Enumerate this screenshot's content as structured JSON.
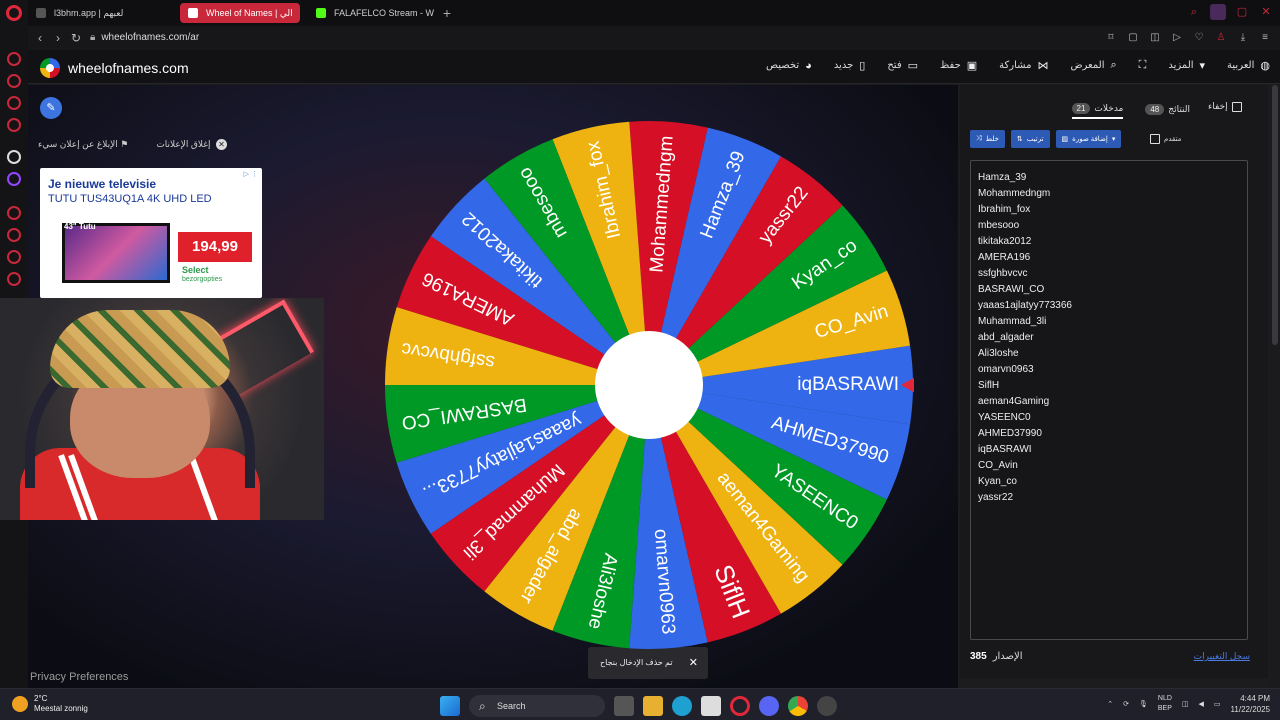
{
  "browser": {
    "tabs": [
      {
        "label": "l3bhm.app | لعبهم",
        "icon_color": "#3a3a3a",
        "active": false
      },
      {
        "label": "Wheel of Names | الي",
        "icon_color": "#ffffff",
        "active": true
      },
      {
        "label": "FALAFELCO Stream - Wat",
        "icon_color": "#53fc18",
        "active": false
      }
    ],
    "new_tab": "+",
    "url": "wheelofnames.com/ar"
  },
  "app": {
    "brand": "wheelofnames.com",
    "menu": [
      {
        "label": "العربية",
        "icon": "globe-icon"
      },
      {
        "label": "المزيد",
        "icon": "chevron-down-icon"
      },
      {
        "label": "",
        "icon": "fullscreen-icon"
      },
      {
        "label": "المعرض",
        "icon": "search-icon"
      },
      {
        "label": "مشاركة",
        "icon": "share-icon"
      },
      {
        "label": "حفظ",
        "icon": "save-icon"
      },
      {
        "label": "فتح",
        "icon": "folder-icon"
      },
      {
        "label": "جديد",
        "icon": "new-icon"
      },
      {
        "label": "تخصيص",
        "icon": "palette-icon"
      }
    ]
  },
  "main": {
    "ad_links": {
      "report": "الإبلاغ عن إعلان سيء",
      "close_ads": "إغلاق الإعلانات"
    },
    "ad": {
      "headline": "Je nieuwe televisie",
      "subline": "TUTU TUS43UQ1A 4K UHD LED",
      "tv_label": "43\" Tutu",
      "price": "194,99",
      "select": "Select",
      "select_sub": "bezorgopties",
      "ad_tag": "▷ ⋮"
    },
    "privacy": "Privacy Preferences",
    "toast": {
      "message": "تم حذف الإدخال بنجاح",
      "close": "✕"
    }
  },
  "wheel": {
    "colors": [
      "#3369e8",
      "#d50f25",
      "#eeb211",
      "#009925"
    ],
    "pointer_color": "#e0283a",
    "center_color": "#ffffff",
    "slices": [
      "iqBASRAWI",
      "CO_Avin",
      "Kyan_co",
      "yassr22",
      "Hamza_39",
      "Mohammedngm",
      "Ibrahim_fox",
      "mbesooo",
      "tikitaka2012",
      "AMERA196",
      "ssfghbvcvc",
      "BASRAWI_CO",
      "yaaas1ajlatyy7733...",
      "Muhammad_3li",
      "abd_algader",
      "Ali3loshe",
      "omarvn0963",
      "SiflH",
      "aeman4Gaming",
      "YASEENC0",
      "AHMED37990"
    ]
  },
  "panel": {
    "hide_label": "إخفاء",
    "tabs": [
      {
        "label": "مدخلات",
        "count": "21",
        "active": true
      },
      {
        "label": "النتائج",
        "count": "48",
        "active": false
      }
    ],
    "buttons": [
      {
        "label": "خلط",
        "icon": "shuffle-icon"
      },
      {
        "label": "ترتيب",
        "icon": "sort-icon"
      },
      {
        "label": "إضافة صورة",
        "icon": "image-icon"
      }
    ],
    "advanced_label": "متقدم",
    "entries": [
      "Hamza_39",
      "Mohammedngm",
      "Ibrahim_fox",
      "mbesooo",
      "tikitaka2012",
      "AMERA196",
      "ssfghbvcvc",
      "BASRAWI_CO",
      "yaaas1ajlatyy773366",
      "Muhammad_3li",
      "abd_algader",
      "Ali3loshe",
      "omarvn0963",
      "SiflH",
      "aeman4Gaming",
      "YASEENC0",
      "AHMED37990",
      "iqBASRAWI",
      "CO_Avin",
      "Kyan_co",
      "yassr22"
    ],
    "version_label": "الإصدار",
    "version": "385",
    "changelog": "سجل التغييرات"
  },
  "taskbar": {
    "temp": "2°C",
    "weather": "Meestal zonnig",
    "search": "Search",
    "lang": "NLD",
    "region": "BEP",
    "time": "4:44 PM",
    "date": "11/22/2025"
  }
}
